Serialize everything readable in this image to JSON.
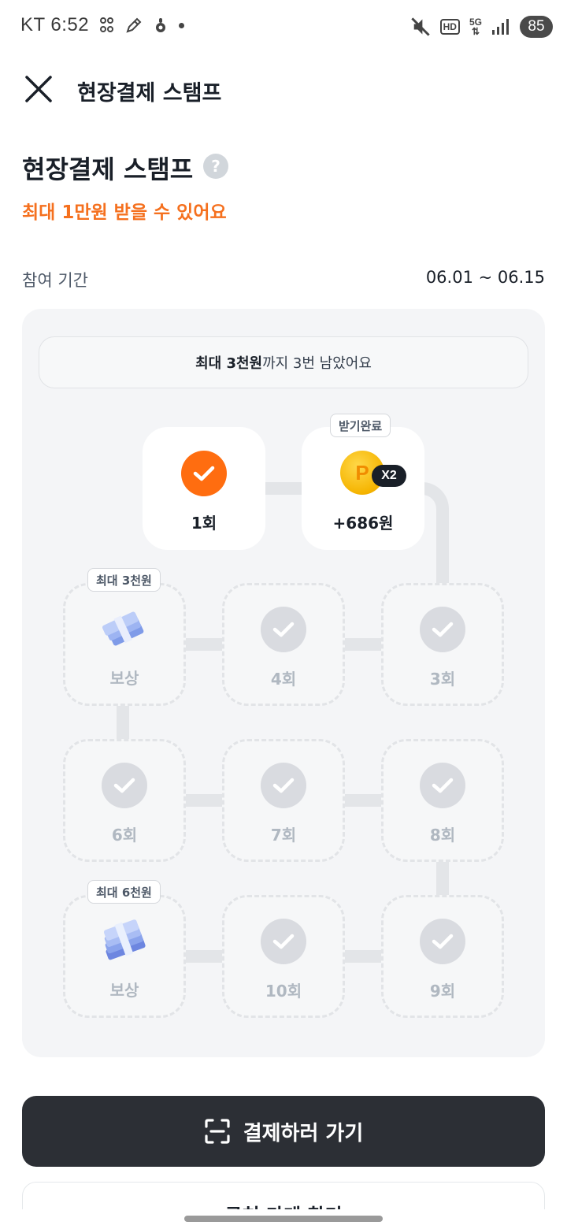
{
  "status_bar": {
    "carrier": "KT",
    "time": "6:52",
    "network": "5G",
    "hd": "HD",
    "battery": "85"
  },
  "header": {
    "title": "현장결제 스탬프"
  },
  "page": {
    "title": "현장결제 스탬프",
    "help": "?",
    "subtitle": "최대 1만원 받을 수 있어요",
    "period_label": "참여 기간",
    "period_value": "06.01 ~ 06.15"
  },
  "notice": {
    "bold": "최대 3천원",
    "rest": "까지 3번 남았어요"
  },
  "stamps": {
    "s1": {
      "label": "1회"
    },
    "s2": {
      "tag": "받기완료",
      "coin": "P",
      "multiplier": "X2",
      "label": "+686원"
    },
    "s3": {
      "label": "3회"
    },
    "s4": {
      "label": "4회"
    },
    "reward1": {
      "tag": "최대 3천원",
      "label": "보상"
    },
    "s6": {
      "label": "6회"
    },
    "s7": {
      "label": "7회"
    },
    "s8": {
      "label": "8회"
    },
    "s9": {
      "label": "9회"
    },
    "s10": {
      "label": "10회"
    },
    "reward2": {
      "tag": "최대 6천원",
      "label": "보상"
    }
  },
  "cta": {
    "label": "결제하러 가기"
  },
  "secondary": {
    "label": "근처 가게 찾기"
  },
  "colors": {
    "accent_orange": "#ff6d10",
    "subtitle_orange": "#f5701e",
    "cta_bg": "#2c2f35",
    "board_bg": "#f4f5f7",
    "coin_gold": "#f5b400"
  }
}
